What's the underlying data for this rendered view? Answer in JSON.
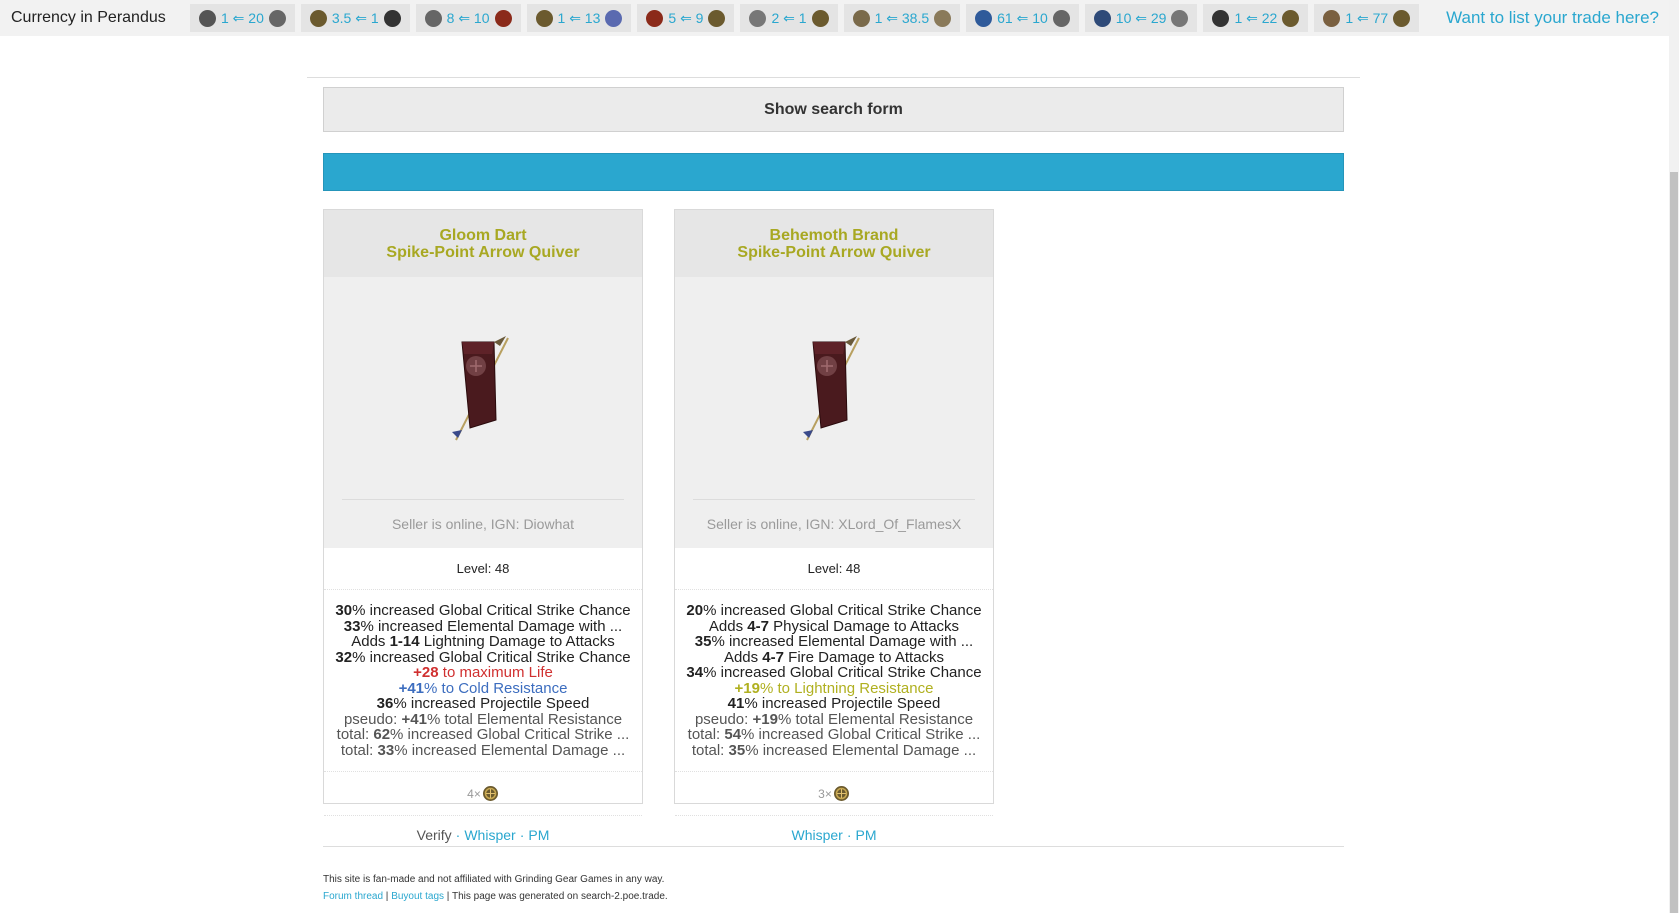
{
  "topbar": {
    "title": "Currency in Perandus",
    "list_link": "Want to list your trade here?",
    "rates": [
      {
        "text": "1 ⇐ 20",
        "left_icon": "scrap-icon",
        "right_icon": "chisel-icon",
        "left_color": "#555555",
        "right_color": "#666666"
      },
      {
        "text": "3.5 ⇐ 1",
        "left_icon": "chaos-orb-icon",
        "right_icon": "fusing-orb-icon",
        "left_color": "#6b5a2e",
        "right_color": "#333333"
      },
      {
        "text": "8 ⇐ 10",
        "left_icon": "whetstone-icon",
        "right_icon": "jeweller-orb-icon",
        "left_color": "#666666",
        "right_color": "#8b2a1a"
      },
      {
        "text": "1 ⇐ 13",
        "left_icon": "chaos-orb-icon",
        "right_icon": "chromatic-orb-icon",
        "left_color": "#6b5a2e",
        "right_color": "#5a6ab0"
      },
      {
        "text": "5 ⇐ 9",
        "left_icon": "jeweller-orb-icon",
        "right_icon": "chaos-orb-icon",
        "left_color": "#8b2a1a",
        "right_color": "#6b5a2e"
      },
      {
        "text": "2 ⇐ 1",
        "left_icon": "glassblower-icon",
        "right_icon": "chaos-orb-icon",
        "left_color": "#777777",
        "right_color": "#6b5a2e"
      },
      {
        "text": "1 ⇐ 38.5",
        "left_icon": "exalted-orb-icon",
        "right_icon": "alchemy-orb-icon",
        "left_color": "#7a6a4a",
        "right_color": "#8a7a5a"
      },
      {
        "text": "61 ⇐ 10",
        "left_icon": "transmutation-icon",
        "right_icon": "chisel-icon",
        "left_color": "#2f5a9a",
        "right_color": "#666666"
      },
      {
        "text": "10 ⇐ 29",
        "left_icon": "regal-orb-icon",
        "right_icon": "bauble-icon",
        "left_color": "#2e4a78",
        "right_color": "#777777"
      },
      {
        "text": "1 ⇐ 22",
        "left_icon": "vaal-orb-icon",
        "right_icon": "chaos-orb-icon",
        "left_color": "#333333",
        "right_color": "#6b5a2e"
      },
      {
        "text": "1 ⇐ 77",
        "left_icon": "divine-orb-icon",
        "right_icon": "chaos-orb-icon",
        "left_color": "#7a6040",
        "right_color": "#6b5a2e"
      }
    ]
  },
  "search": {
    "label": "Show search form"
  },
  "items": [
    {
      "name": "Gloom Dart",
      "base": "Spike-Point Arrow Quiver",
      "seller": "Seller is online, IGN: Diowhat",
      "level": "Level: 48",
      "mods": [
        {
          "val": "30",
          "text": "% increased Global Critical Strike Chance",
          "cls": ""
        },
        {
          "val": "33",
          "text": "% increased Elemental Damage with ...",
          "cls": ""
        },
        {
          "pre": "Adds ",
          "val": "1-14",
          "text": " Lightning Damage to Attacks",
          "cls": ""
        },
        {
          "val": "32",
          "text": "% increased Global Critical Strike Chance",
          "cls": ""
        },
        {
          "val": "+28",
          "text": " to maximum Life",
          "cls": "red"
        },
        {
          "val": "+41",
          "text": "% to Cold Resistance",
          "cls": "blue"
        },
        {
          "val": "36",
          "text": "% increased Projectile Speed",
          "cls": ""
        },
        {
          "pre": "pseudo: ",
          "val": "+41",
          "text": "% total Elemental Resistance",
          "cls": "pseudo"
        },
        {
          "pre": "total: ",
          "val": "62",
          "text": "% increased Global Critical Strike ...",
          "cls": "pseudo"
        },
        {
          "pre": "total: ",
          "val": "33",
          "text": "% increased Elemental Damage ...",
          "cls": "pseudo"
        }
      ],
      "price": "4×",
      "price_icon": "chaos-orb-icon",
      "actions": [
        "Verify",
        "Whisper",
        "PM"
      ]
    },
    {
      "name": "Behemoth Brand",
      "base": "Spike-Point Arrow Quiver",
      "seller": "Seller is online, IGN: XLord_Of_FlamesX",
      "level": "Level: 48",
      "mods": [
        {
          "val": "20",
          "text": "% increased Global Critical Strike Chance",
          "cls": ""
        },
        {
          "pre": "Adds ",
          "val": "4-7",
          "text": " Physical Damage to Attacks",
          "cls": ""
        },
        {
          "val": "35",
          "text": "% increased Elemental Damage with ...",
          "cls": ""
        },
        {
          "pre": "Adds ",
          "val": "4-7",
          "text": " Fire Damage to Attacks",
          "cls": ""
        },
        {
          "val": "34",
          "text": "% increased Global Critical Strike Chance",
          "cls": ""
        },
        {
          "val": "+19",
          "text": "% to Lightning Resistance",
          "cls": "yellow"
        },
        {
          "val": "41",
          "text": "% increased Projectile Speed",
          "cls": ""
        },
        {
          "pre": "pseudo: ",
          "val": "+19",
          "text": "% total Elemental Resistance",
          "cls": "pseudo"
        },
        {
          "pre": "total: ",
          "val": "54",
          "text": "% increased Global Critical Strike ...",
          "cls": "pseudo"
        },
        {
          "pre": "total: ",
          "val": "35",
          "text": "% increased Elemental Damage ...",
          "cls": "pseudo"
        }
      ],
      "price": "3×",
      "price_icon": "chaos-orb-icon",
      "actions": [
        "Whisper",
        "PM"
      ]
    }
  ],
  "footer": {
    "line1": "This site is fan-made and not affiliated with Grinding Gear Games in any way.",
    "forum": "Forum thread",
    "sep1": " | ",
    "buyout": "Buyout tags",
    "line2_rest": " | This page was generated on search-2.poe.trade."
  }
}
